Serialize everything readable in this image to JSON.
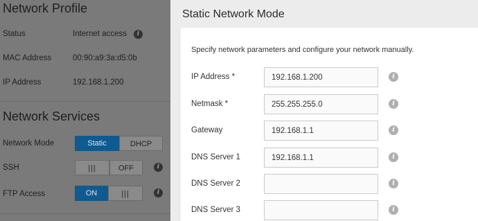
{
  "profile": {
    "heading": "Network Profile",
    "rows": [
      {
        "label": "Status",
        "value": "Internet access"
      },
      {
        "label": "MAC Address",
        "value": "00:90:a9:3a:d5:0b"
      },
      {
        "label": "IP Address",
        "value": "192.168.1.200"
      }
    ]
  },
  "services": {
    "heading": "Network Services",
    "network_mode_label": "Network Mode",
    "mode_options": [
      "Static",
      "DHCP"
    ],
    "mode_selected": "Static",
    "ssh_label": "SSH",
    "ssh_state": "OFF",
    "ftp_label": "FTP Access",
    "ftp_state": "ON",
    "grip": "|||"
  },
  "modal": {
    "title": "Static Network Mode",
    "description": "Specify network parameters and configure your network manually.",
    "fields": [
      {
        "label": "IP Address *",
        "value": "192.168.1.200"
      },
      {
        "label": "Netmask *",
        "value": "255.255.255.0"
      },
      {
        "label": "Gateway",
        "value": "192.168.1.1"
      },
      {
        "label": "DNS Server 1",
        "value": "192.168.1.1"
      },
      {
        "label": "DNS Server 2",
        "value": ""
      },
      {
        "label": "DNS Server 3",
        "value": ""
      }
    ],
    "info_glyph": "i"
  },
  "colors": {
    "accent": "#0f5a8f",
    "overlay": "#7a7a7a",
    "modal_bg": "#ececec"
  }
}
